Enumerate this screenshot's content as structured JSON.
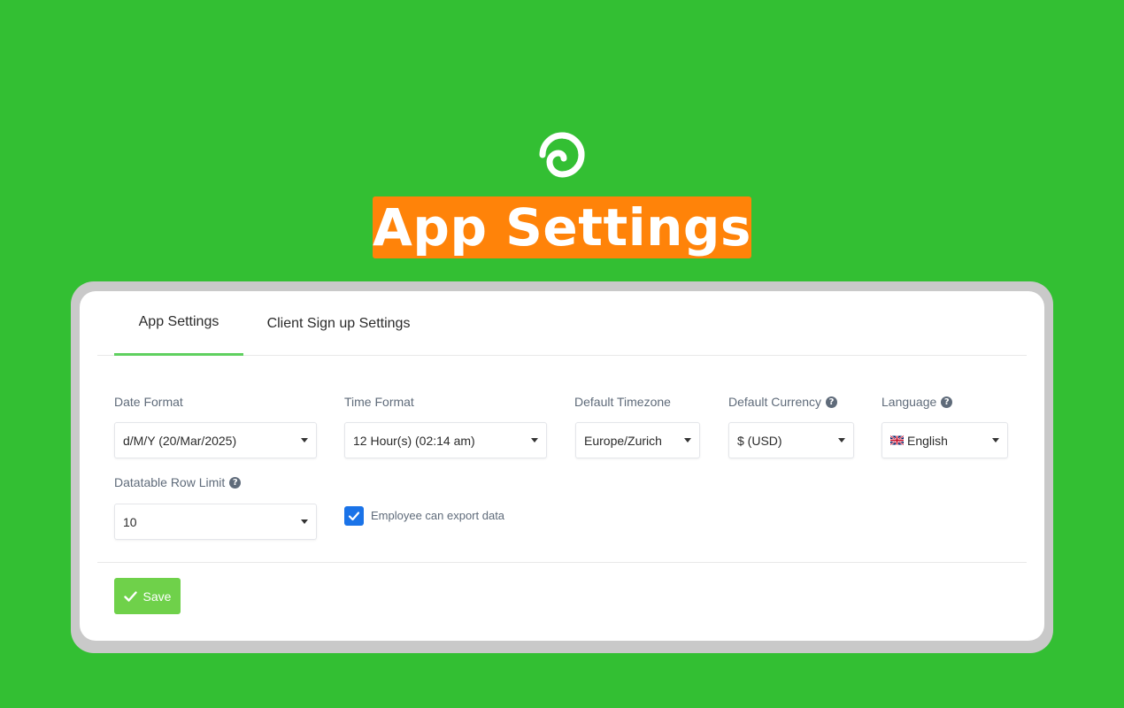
{
  "hero": {
    "title": "App Settings"
  },
  "tabs": [
    {
      "label": "App Settings",
      "active": true
    },
    {
      "label": "Client Sign up Settings",
      "active": false
    }
  ],
  "form": {
    "date_format": {
      "label": "Date Format",
      "value": "d/M/Y (20/Mar/2025)"
    },
    "time_format": {
      "label": "Time Format",
      "value": "12 Hour(s) (02:14 am)"
    },
    "timezone": {
      "label": "Default Timezone",
      "value": "Europe/Zurich"
    },
    "currency": {
      "label": "Default Currency",
      "value": "$ (USD)"
    },
    "language": {
      "label": "Language",
      "value": "English",
      "flag": "uk-flag-icon"
    },
    "row_limit": {
      "label": "Datatable Row Limit",
      "value": "10"
    },
    "export": {
      "label": "Employee can export data",
      "checked": true
    }
  },
  "actions": {
    "save_label": "Save"
  },
  "colors": {
    "background": "#33bf33",
    "banner": "#ff8309",
    "accent": "#5fd05f",
    "save": "#6fd14a",
    "checkbox": "#1a73e8"
  }
}
